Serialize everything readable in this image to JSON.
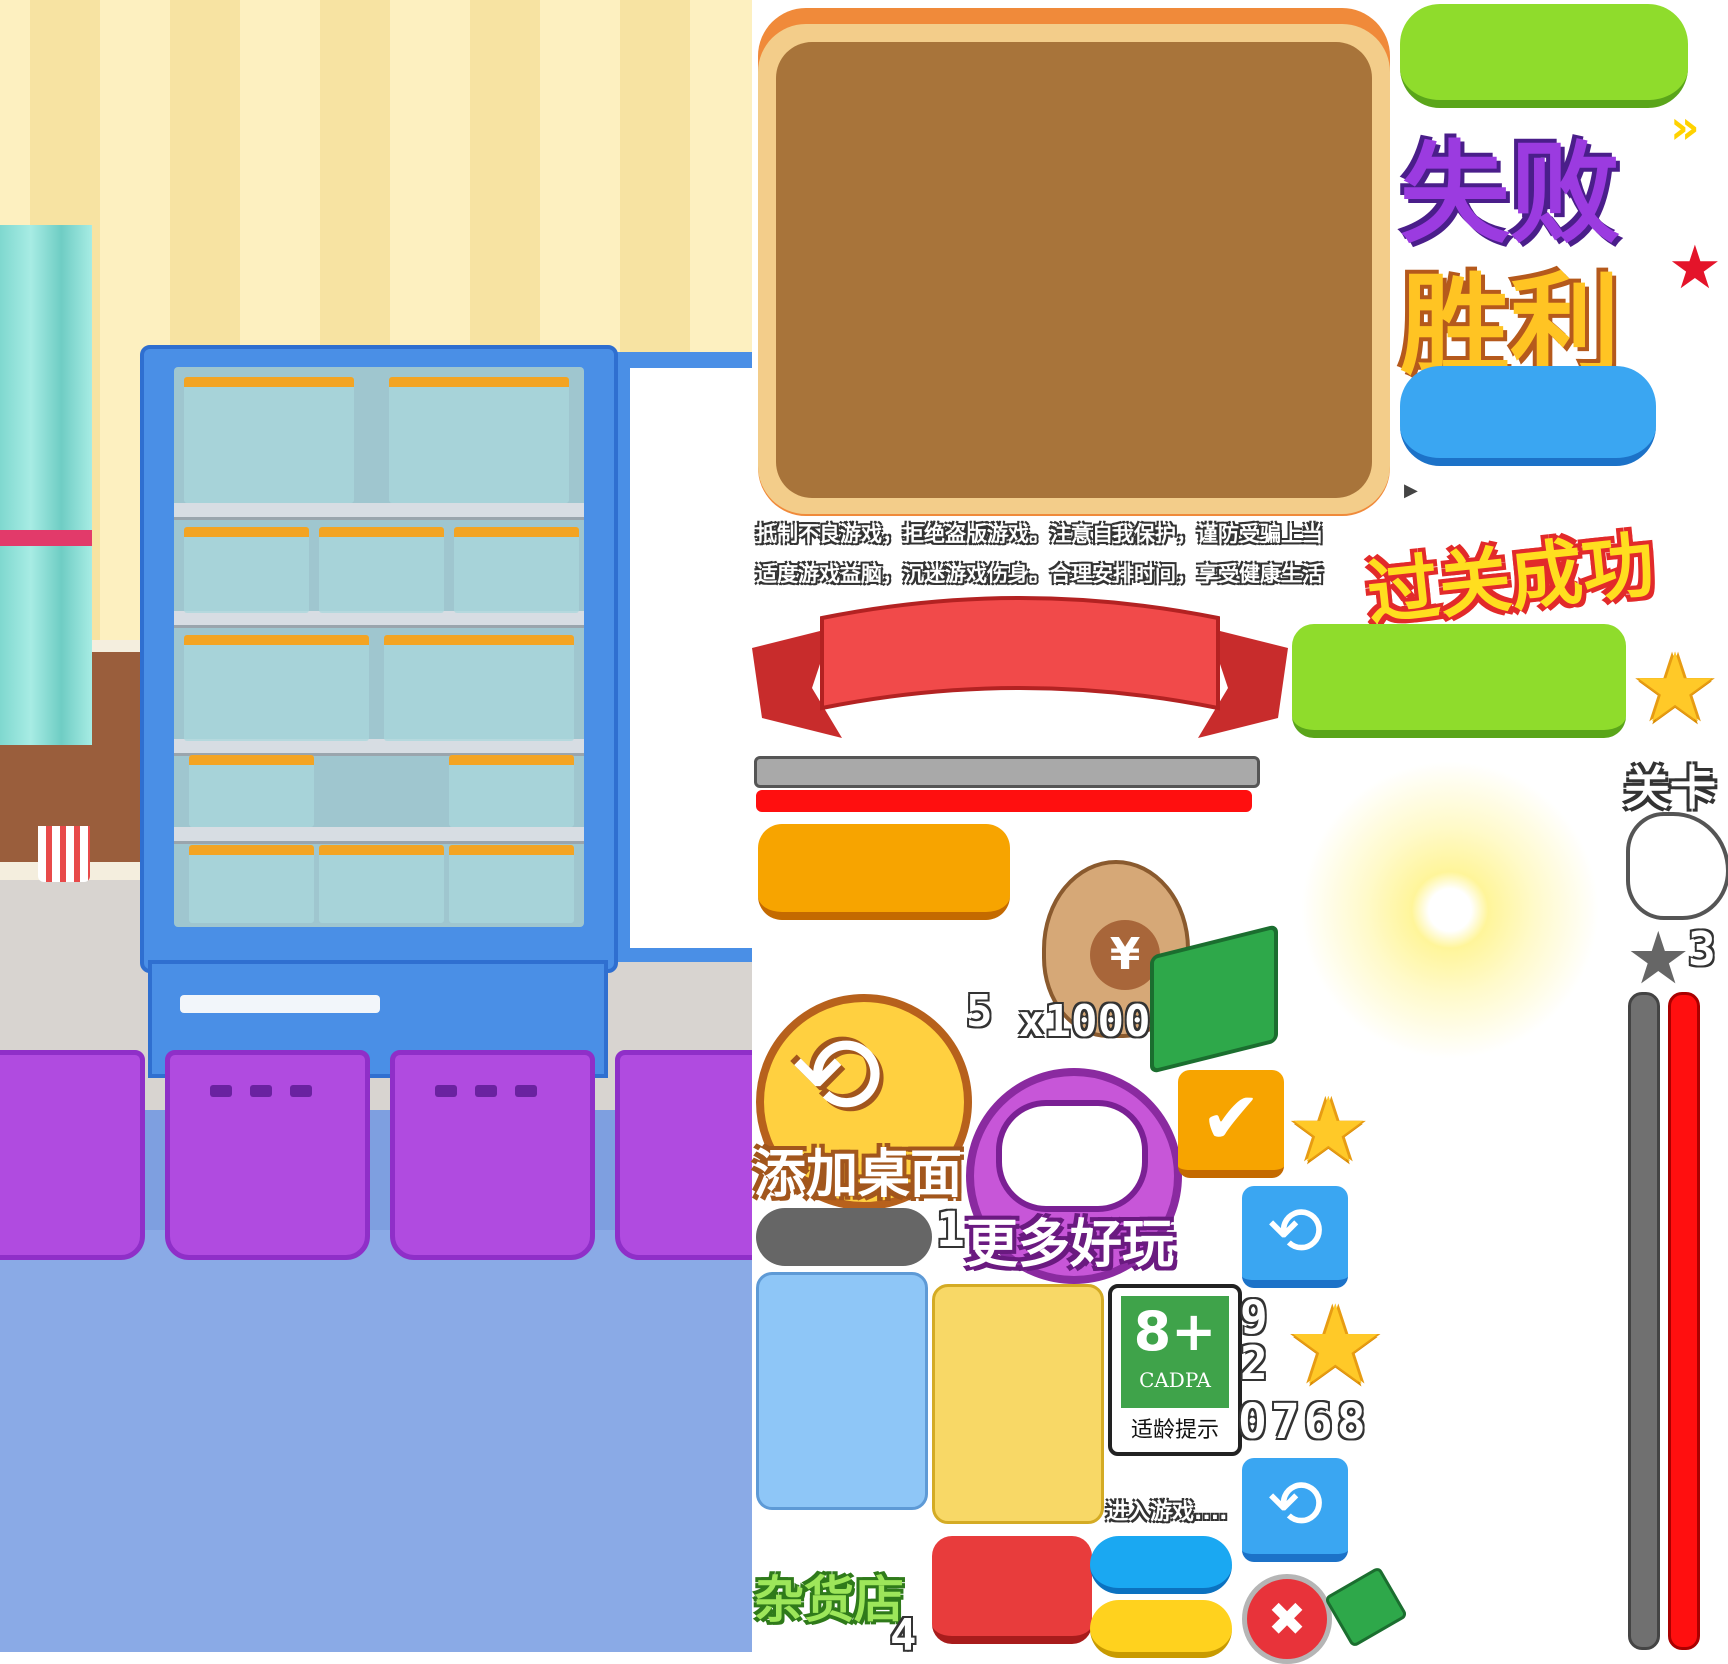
{
  "notices": {
    "line1": "抵制不良游戏，拒绝盗版游戏。注意自我保护，谨防受骗上当",
    "line2": "适度游戏益脑，沉迷游戏伤身。合理安排时间，享受健康生活"
  },
  "titles": {
    "fail": "失败",
    "win": "胜利",
    "level_clear": "过关成功",
    "level": "关卡",
    "add_desktop": "添加桌面",
    "more_games": "更多好玩",
    "grocery": "杂货店",
    "entering": "进入游戏....",
    "age_hint": "适龄提示"
  },
  "rating": {
    "age": "8+",
    "org": "CADPA"
  },
  "numbers": {
    "five": "5",
    "times1000": "x1000",
    "one": "1",
    "three": "3",
    "nine": "9",
    "two": "2",
    "digits": "0768",
    "four": "4"
  },
  "icons": {
    "arrow": "»",
    "play": "▶",
    "check": "✔",
    "cross": "✖",
    "yen": "¥",
    "star": "★",
    "refresh": "⟲"
  },
  "colors": {
    "green": "#8fdc2c",
    "blue": "#3aa6f2",
    "orange": "#f7a400",
    "red_banner": "#e63c3c",
    "purple": "#9b3be0"
  }
}
